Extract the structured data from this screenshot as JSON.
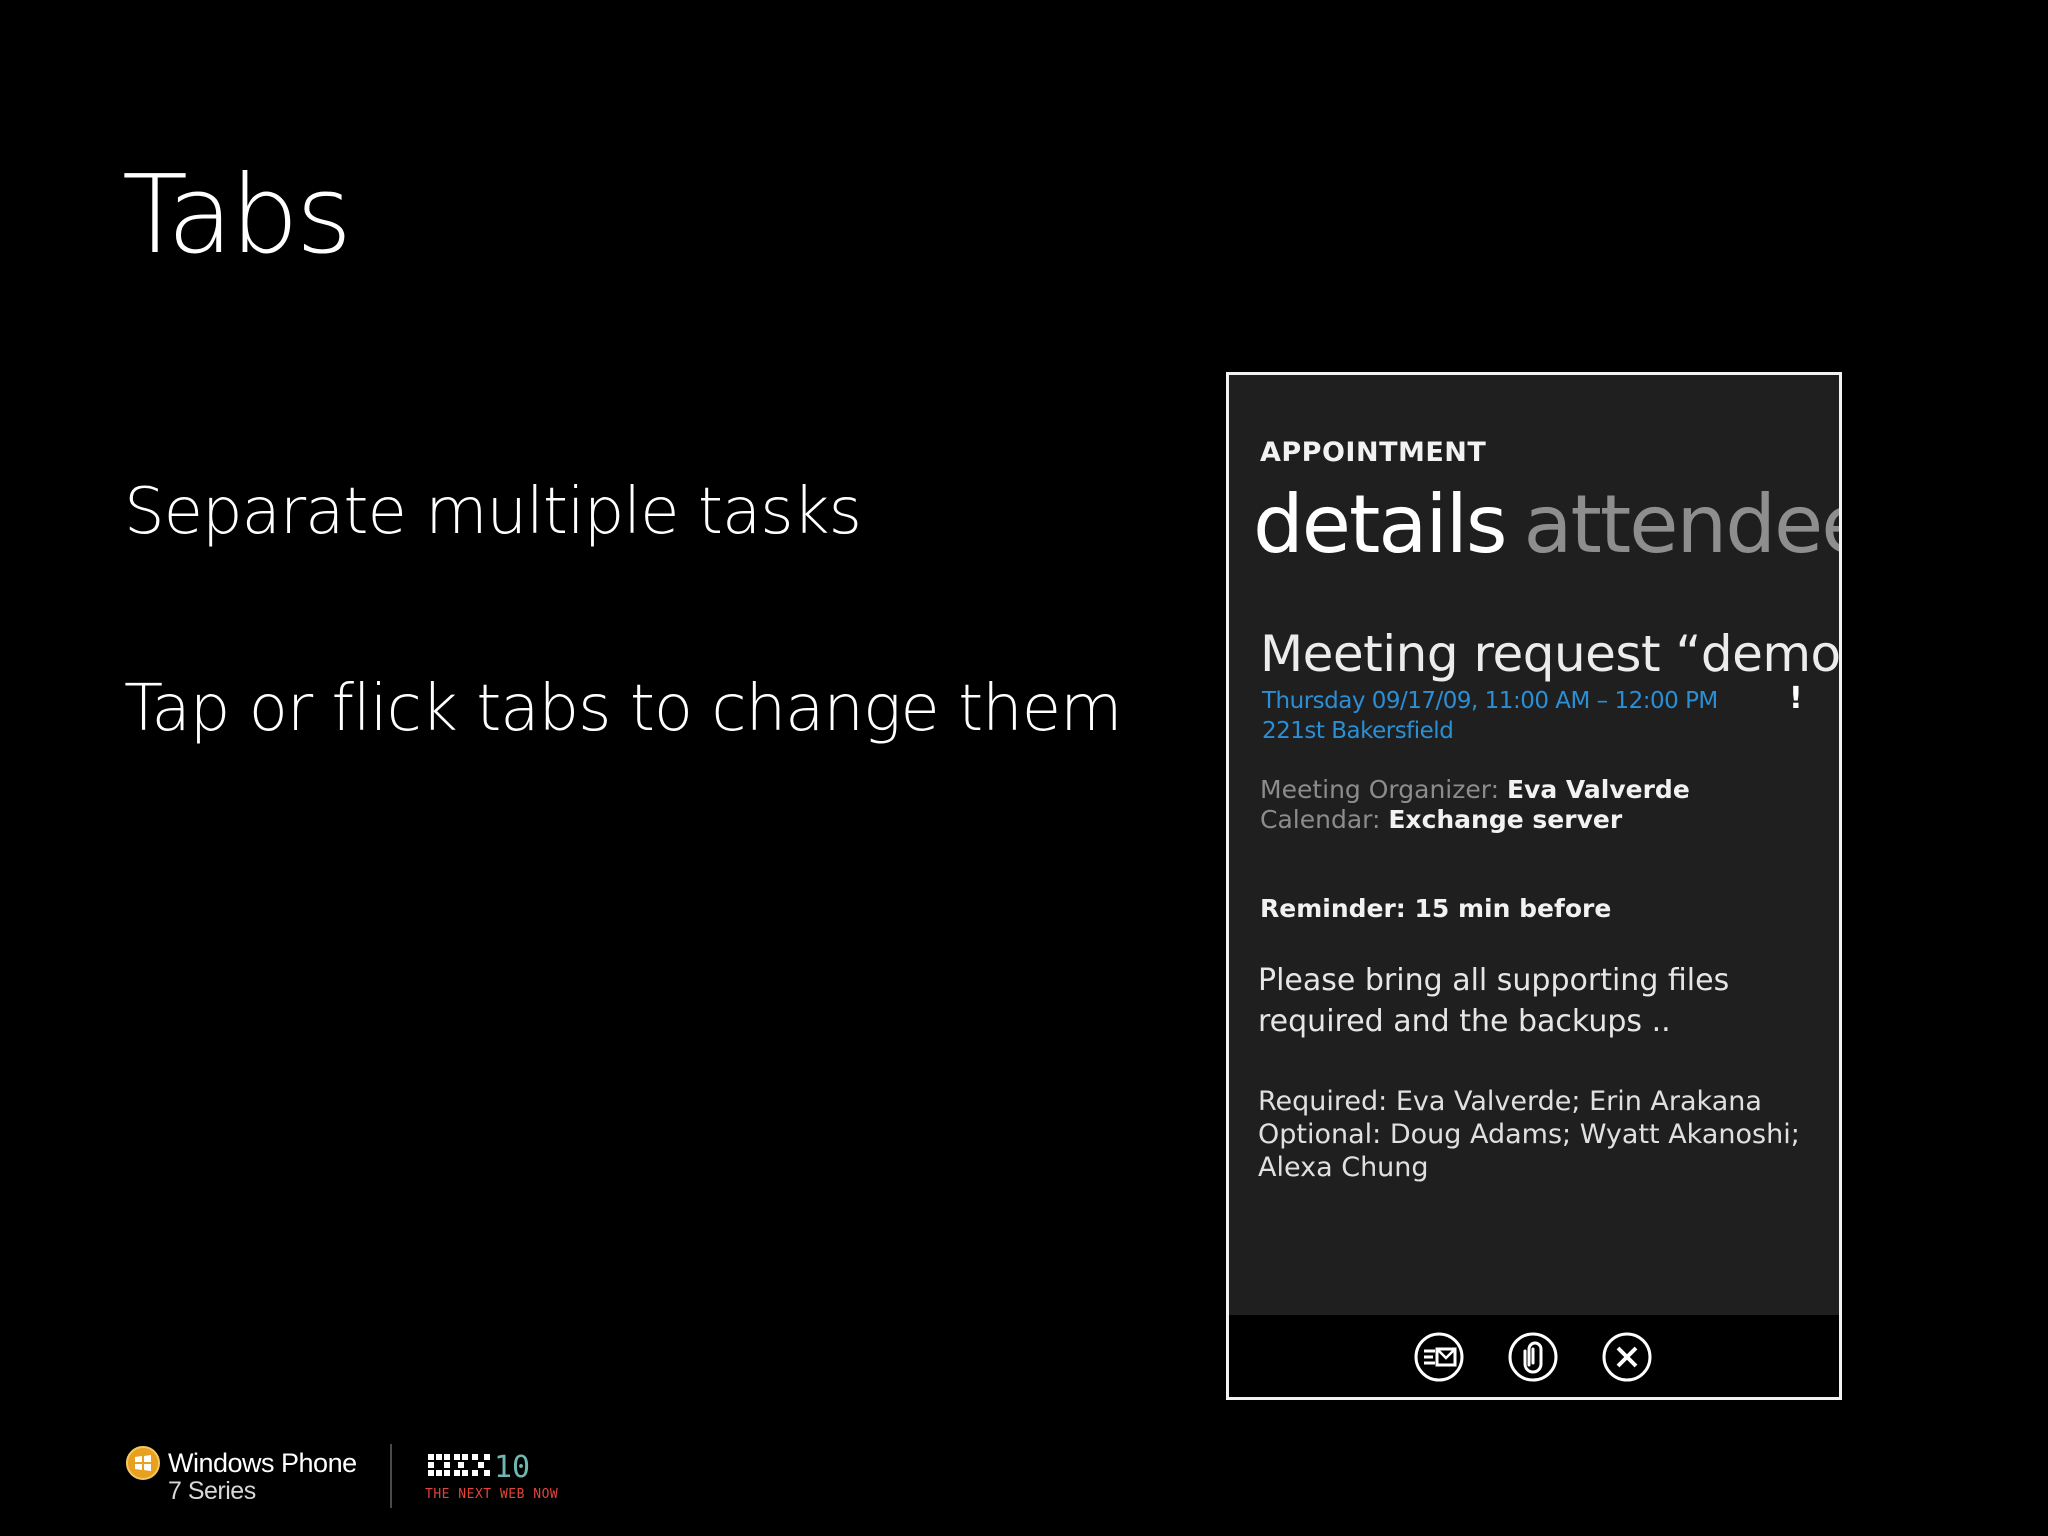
{
  "slide": {
    "title": "Tabs",
    "bullets": [
      "Separate multiple tasks",
      "Tap or flick tabs to change them"
    ]
  },
  "phone": {
    "app_title": "APPOINTMENT",
    "pivot": {
      "active": "details",
      "inactive": "attendee"
    },
    "meeting_title": "Meeting request “demo",
    "date_time": "Thursday 09/17/09, 11:00 AM – 12:00 PM",
    "location": "221st Bakersfield",
    "importance_mark": "!",
    "organizer": {
      "label": "Meeting Organizer:",
      "value": "Eva Valverde"
    },
    "calendar": {
      "label": "Calendar:",
      "value": "Exchange server"
    },
    "reminder": "Reminder: 15 min before",
    "notes": "Please bring all supporting files required and the backups ..",
    "required": "Required: Eva Valverde; Erin Arakana",
    "optional": "Optional: Doug Adams; Wyatt Akanoshi; Alexa Chung",
    "app_bar": {
      "icons": [
        "respond-icon",
        "attach-icon",
        "close-icon"
      ]
    }
  },
  "footer": {
    "brand_name": "Windows Phone",
    "brand_series": "7 Series",
    "event_logo_icon": "mix10-logo",
    "event_tagline": "THE NEXT WEB NOW"
  },
  "colors": {
    "background": "#000000",
    "phone_background": "#1f1f1f",
    "accent_blue": "#2b8fd6",
    "mix_red": "#e0443a",
    "mix_teal": "#6fb7b0"
  }
}
